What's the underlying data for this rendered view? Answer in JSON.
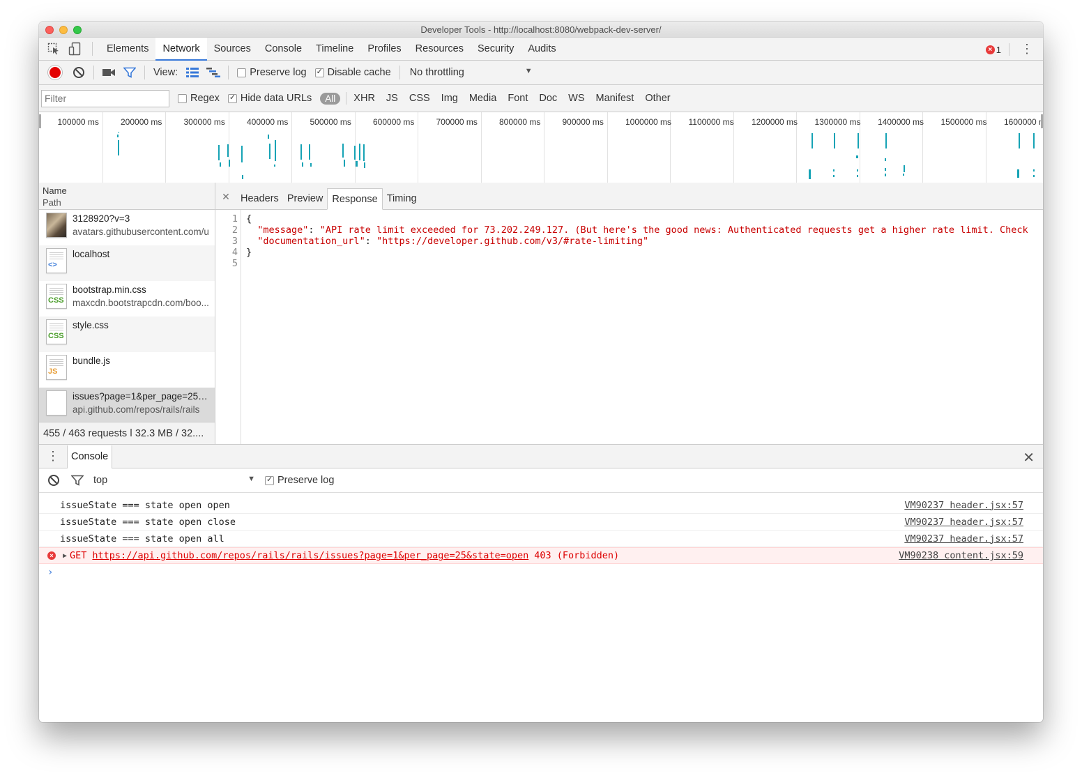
{
  "window": {
    "title": "Developer Tools - http://localhost:8080/webpack-dev-server/"
  },
  "tabs": [
    {
      "label": "Elements"
    },
    {
      "label": "Network",
      "active": true
    },
    {
      "label": "Sources"
    },
    {
      "label": "Console"
    },
    {
      "label": "Timeline"
    },
    {
      "label": "Profiles"
    },
    {
      "label": "Resources"
    },
    {
      "label": "Security"
    },
    {
      "label": "Audits"
    }
  ],
  "error_count": "1",
  "toolbar": {
    "view_label": "View:",
    "preserve_log": "Preserve log",
    "disable_cache": "Disable cache",
    "throttling": "No throttling"
  },
  "filter": {
    "placeholder": "Filter",
    "regex": "Regex",
    "hide_data_urls": "Hide data URLs",
    "types": [
      "All",
      "XHR",
      "JS",
      "CSS",
      "Img",
      "Media",
      "Font",
      "Doc",
      "WS",
      "Manifest",
      "Other"
    ]
  },
  "overview": {
    "ticks": [
      "100000 ms",
      "200000 ms",
      "300000 ms",
      "400000 ms",
      "500000 ms",
      "600000 ms",
      "700000 ms",
      "800000 ms",
      "900000 ms",
      "1000000 ms",
      "1100000 ms",
      "1200000 ms",
      "1300000 ms",
      "1400000 ms",
      "1500000 ms",
      "1600000 ms"
    ]
  },
  "requests_panel": {
    "col_name": "Name",
    "col_path": "Path",
    "requests": [
      {
        "name": "3128920?v=3",
        "path": "avatars.githubusercontent.com/u",
        "icon": "image-icon"
      },
      {
        "name": "localhost",
        "path": "",
        "icon": "html-doc-icon",
        "tag": "<>"
      },
      {
        "name": "bootstrap.min.css",
        "path": "maxcdn.bootstrapcdn.com/boo...",
        "icon": "css-file-icon",
        "tag": "CSS"
      },
      {
        "name": "style.css",
        "path": "",
        "icon": "css-file-icon",
        "tag": "CSS"
      },
      {
        "name": "bundle.js",
        "path": "",
        "icon": "js-file-icon",
        "tag": "JS"
      },
      {
        "name": "issues?page=1&per_page=25&...",
        "path": "api.github.com/repos/rails/rails",
        "icon": "blank-file-icon",
        "tag": ""
      }
    ],
    "summary": "455 / 463 requests  ǀ  32.3 MB / 32...."
  },
  "detail_tabs": [
    "Headers",
    "Preview",
    "Response",
    "Timing"
  ],
  "response": {
    "line_numbers": [
      "1",
      "2",
      "3",
      "4",
      "5"
    ],
    "open_brace": "{",
    "close_brace": "}",
    "message_key": "\"message\"",
    "message_value": "\"API rate limit exceeded for 73.202.249.127. (But here's the good news: Authenticated requests get a higher rate limit. Check",
    "doc_key": "\"documentation_url\"",
    "doc_value": "\"https://developer.github.com/v3/#rate-limiting\""
  },
  "console": {
    "tab_label": "Console",
    "context": "top",
    "preserve_log": "Preserve log",
    "messages": [
      {
        "text": "issueState === state open open",
        "source": "VM90237 header.jsx:57"
      },
      {
        "text": "issueState === state open close",
        "source": "VM90237 header.jsx:57"
      },
      {
        "text": "issueState === state open all",
        "source": "VM90237 header.jsx:57"
      }
    ],
    "error": {
      "method": "GET",
      "url": "https://api.github.com/repos/rails/rails/issues?page=1&per_page=25&state=open",
      "status": "403 (Forbidden)",
      "source": "VM90238 content.jsx:59"
    }
  },
  "colors": {
    "accent": "#3879d9",
    "error": "#d00000",
    "record": "#e30000",
    "waterfall": "#16a3b5"
  }
}
